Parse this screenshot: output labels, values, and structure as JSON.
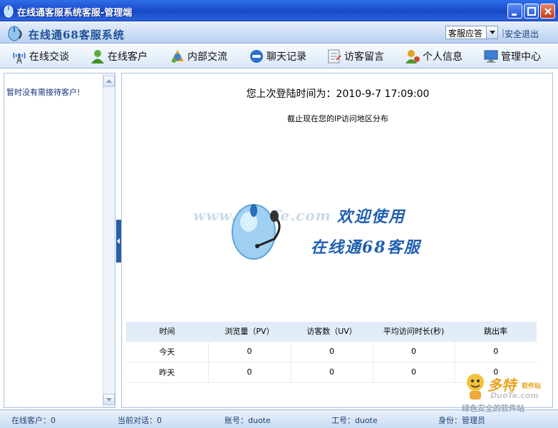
{
  "window": {
    "title": "在线通客服系统客服-管理端"
  },
  "header": {
    "app_name": "在线通68客服系统",
    "status_select": "客服应答",
    "separator": "|",
    "logout": "安全退出"
  },
  "nav": {
    "items": [
      {
        "label": "在线交谈",
        "icon": "signal-tower-icon"
      },
      {
        "label": "在线客户",
        "icon": "customer-icon"
      },
      {
        "label": "内部交流",
        "icon": "internal-chat-icon"
      },
      {
        "label": "聊天记录",
        "icon": "chat-record-icon"
      },
      {
        "label": "访客留言",
        "icon": "message-note-icon"
      },
      {
        "label": "个人信息",
        "icon": "user-info-icon"
      },
      {
        "label": "管理中心",
        "icon": "monitor-icon"
      }
    ]
  },
  "sidebar": {
    "waiting_text": "暂时没有需接待客户!"
  },
  "main": {
    "last_login": "您上次登陆时间为：2010-9-7 17:09:00",
    "ip_title": "截止现在您的IP访问地区分布",
    "watermark": "www.DuoTe.com",
    "welcome_line1": "欢迎使用",
    "welcome_line2": "在线通68客服"
  },
  "stats_table": {
    "headers": [
      "时间",
      "浏览量（PV）",
      "访客数（UV）",
      "平均访问时长(秒)",
      "跳出率"
    ],
    "rows": [
      [
        "今天",
        "0",
        "0",
        "0",
        "0"
      ],
      [
        "昨天",
        "0",
        "0",
        "0",
        "0"
      ]
    ]
  },
  "statusbar": {
    "online_customers": "在线客户：0",
    "current_sessions": "当前对话：0",
    "account": "账号：duote",
    "job_number": "工号：duote",
    "role": "身份：管理员"
  },
  "corner_logo": {
    "brand": "多特",
    "brand_sub": "软件站",
    "url": "DuoTe.com",
    "tag": "绿色安全的软件站"
  },
  "colors": {
    "titlebar": "#1c4fd0",
    "accent": "#1f5fb0",
    "header_text": "#1e4f94"
  }
}
